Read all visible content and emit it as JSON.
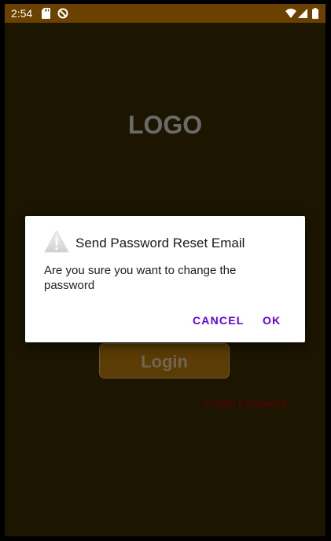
{
  "status_bar": {
    "time": "2:54",
    "icons": [
      "sd-card-icon",
      "no-sync-icon",
      "wifi-icon",
      "signal-icon",
      "battery-icon"
    ]
  },
  "app": {
    "logo_text": "LOGO",
    "login_label": "Login",
    "forgot_password_label": "Forgot Password"
  },
  "dialog": {
    "icon": "warning-icon",
    "title": "Send Password Reset Email",
    "message": "Are you sure you want to change the password",
    "cancel_label": "CANCEL",
    "ok_label": "OK"
  },
  "colors": {
    "status_bar": "#6b4100",
    "background": "#1c1500",
    "accent": "#6200ee",
    "forgot_link": "#5a0000"
  }
}
